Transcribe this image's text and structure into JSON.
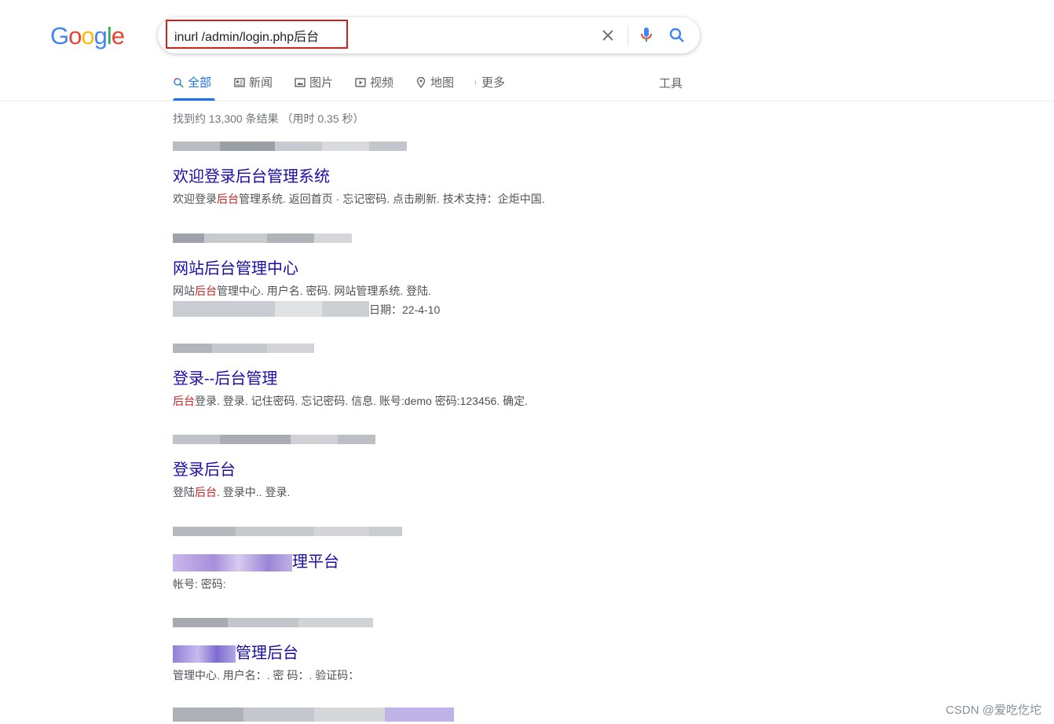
{
  "colors": {
    "accent": "#1a73e8",
    "link": "#1a0dab",
    "highlight_box": "#d0211a",
    "emphasis": "#c5221f"
  },
  "logo": {
    "text": "Google",
    "letters": [
      "G",
      "o",
      "o",
      "g",
      "l",
      "e"
    ],
    "colors": [
      "#4285f4",
      "#ea4335",
      "#fbbc05",
      "#4285f4",
      "#34a853",
      "#ea4335"
    ]
  },
  "search": {
    "query": "inurl /admin/login.php后台",
    "clear_icon": "close-icon",
    "mic_icon": "microphone-icon",
    "search_icon": "search-icon"
  },
  "tabs": [
    {
      "label": "全部",
      "icon": "search-icon",
      "active": true
    },
    {
      "label": "新闻",
      "icon": "news-icon",
      "active": false
    },
    {
      "label": "图片",
      "icon": "image-icon",
      "active": false
    },
    {
      "label": "视频",
      "icon": "video-icon",
      "active": false
    },
    {
      "label": "地图",
      "icon": "map-pin-icon",
      "active": false
    },
    {
      "label": "更多",
      "icon": "more-vert-icon",
      "active": false
    }
  ],
  "tools_label": "工具",
  "stats": "找到约 13,300 条结果 （用时 0.35 秒）",
  "results": [
    {
      "title": "欢迎登录后台管理系统",
      "snippet": [
        {
          "t": "欢迎登录"
        },
        {
          "t": "后台",
          "em": true
        },
        {
          "t": "管理系统. 返回首页 · 忘记密码. 点击刷新. 技术支持：企炬中国."
        }
      ]
    },
    {
      "title": "网站后台管理中心",
      "snippet": [
        {
          "t": "网站"
        },
        {
          "t": "后台",
          "em": true
        },
        {
          "t": "管理中心. 用户名. 密码. 网站管理系统. 登陆."
        }
      ],
      "meta": "日期：22-4-10"
    },
    {
      "title": "登录--后台管理",
      "snippet": [
        {
          "t": "后台",
          "em": true
        },
        {
          "t": "登录. 登录. 记住密码. 忘记密码. 信息. 账号:demo 密码:123456. 确定."
        }
      ]
    },
    {
      "title": "登录后台",
      "snippet": [
        {
          "t": "登陆"
        },
        {
          "t": "后台",
          "em": true
        },
        {
          "t": ". 登录中.. 登录."
        }
      ]
    },
    {
      "title_visible": "理平台",
      "snippet": [
        {
          "t": "帐号: 密码:"
        }
      ]
    },
    {
      "title_visible": "管理后台",
      "snippet": [
        {
          "t": "管理中心. 用户名：. 密 码：. 验证码："
        }
      ]
    }
  ],
  "watermark": "CSDN @爱吃仡坨"
}
